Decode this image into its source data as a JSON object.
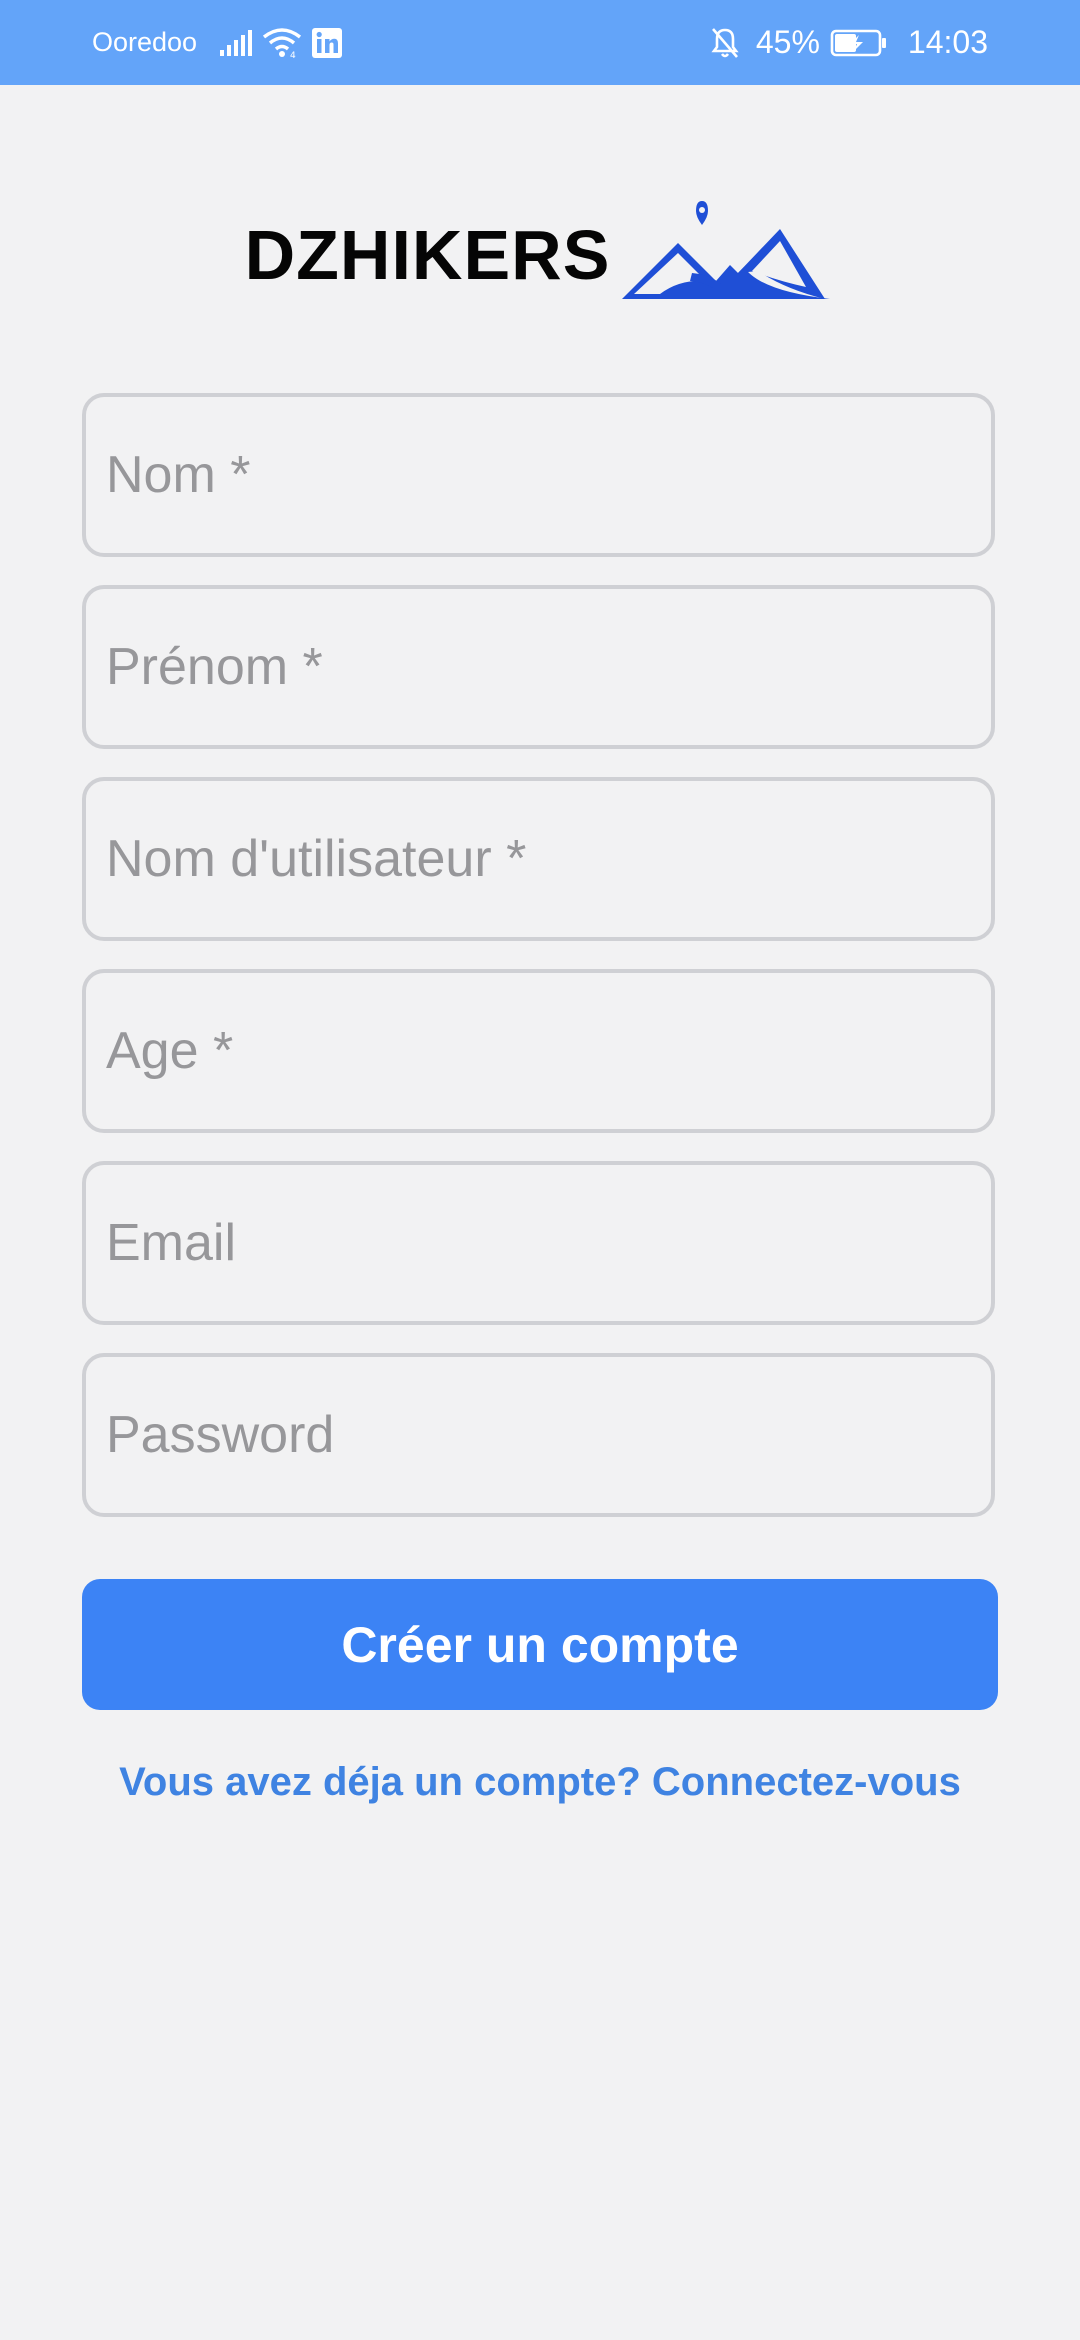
{
  "status_bar": {
    "carrier": "Ooredoo",
    "battery_percent": "45%",
    "time": "14:03",
    "icons": [
      "signal-icon",
      "wifi-icon",
      "linkedin-icon",
      "bell-off-icon",
      "battery-charging-icon"
    ],
    "background": "#63a4f9"
  },
  "logo": {
    "text": "DZHIKERS",
    "icon": "mountain-pin-icon",
    "icon_color": "#1f4fd6"
  },
  "form": {
    "nom_placeholder": "Nom *",
    "prenom_placeholder": "Prénom *",
    "username_placeholder": "Nom d'utilisateur *",
    "age_placeholder": "Age *",
    "email_placeholder": "Email",
    "password_placeholder": "Password"
  },
  "actions": {
    "create_account_label": "Créer un compte",
    "login_link_label": "Vous avez déja un compte? Connectez-vous",
    "accent_color": "#3c83f5"
  }
}
